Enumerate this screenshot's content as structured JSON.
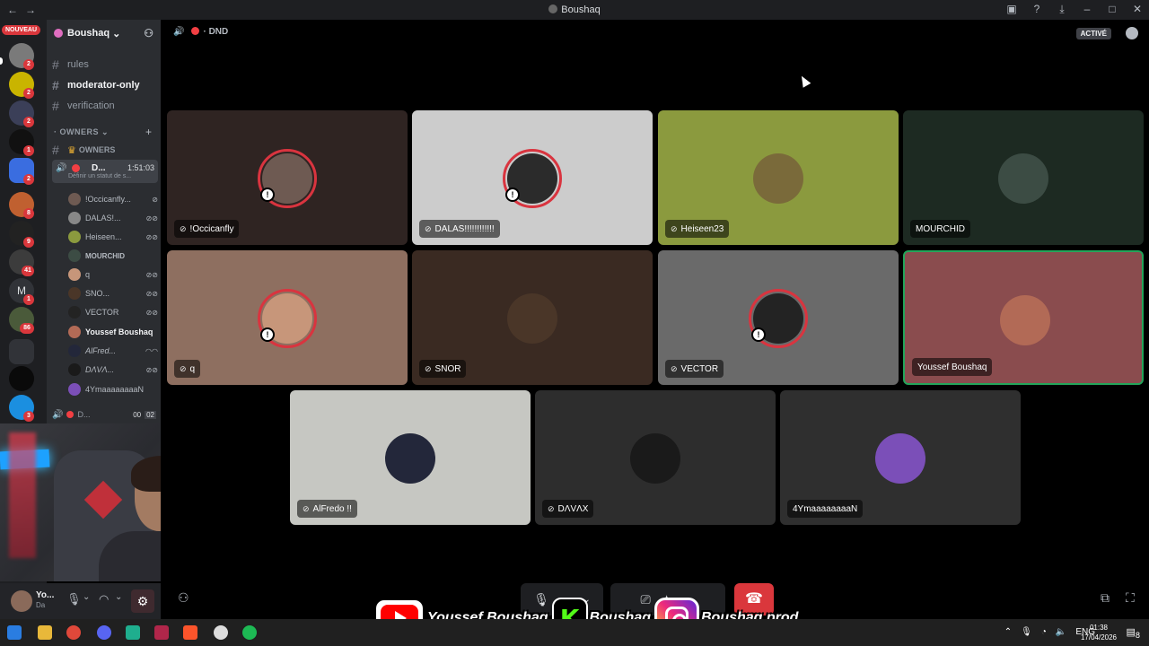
{
  "window": {
    "title": "Boushaq"
  },
  "rail": {
    "new_badge": "NOUVEAU",
    "badges": [
      "2",
      "2",
      "2",
      "1",
      "2",
      "8",
      "9",
      "41",
      "1",
      "86",
      "3"
    ],
    "letter_server": "M"
  },
  "sidebar": {
    "server_name": "Boushaq",
    "channels": [
      {
        "label": "rules"
      },
      {
        "label": "moderator-only"
      },
      {
        "label": "verification"
      }
    ],
    "category_label": "OWNERS",
    "owners_channel": "OWNERS",
    "voice": {
      "name": "D...",
      "time": "1:51:03",
      "status": "Définir un statut de s..."
    },
    "members": [
      {
        "name": "!Occicanfly..."
      },
      {
        "name": "DALAS!..."
      },
      {
        "name": "Heiseen..."
      },
      {
        "name": "MOURCHID"
      },
      {
        "name": "q"
      },
      {
        "name": "SNO..."
      },
      {
        "name": "VECTOR"
      },
      {
        "name": "Youssef Boushaq"
      },
      {
        "name": "AlFred..."
      },
      {
        "name": "DΛVΛ..."
      },
      {
        "name": "4YmaaaaaaaaN"
      }
    ],
    "voice2": {
      "name": "D...",
      "c1": "00",
      "c2": "02"
    }
  },
  "user_panel": {
    "name": "Yo...",
    "status": "Da"
  },
  "stage": {
    "header_status": "DND",
    "activity_label": "ACTIVÉ",
    "tiles": [
      {
        "name": "!Occicanfly",
        "bg": "#2f2422",
        "av": "#6e5a52"
      },
      {
        "name": "DALAS!!!!!!!!!!!!",
        "bg": "#cccccc",
        "av": "#2b2b2b"
      },
      {
        "name": "Heiseen23",
        "bg": "#8b9a3e",
        "av": "#7a6a3a"
      },
      {
        "name": "MOURCHID",
        "bg": "#1d2a22",
        "av": "#3c4c44"
      },
      {
        "name": "q",
        "bg": "#8e6f60",
        "av": "#c7967a"
      },
      {
        "name": "SNOR",
        "bg": "#3a2a22",
        "av": "#4a3628"
      },
      {
        "name": "VECTOR",
        "bg": "#6a6a6a",
        "av": "#232323"
      },
      {
        "name": "Youssef Boushaq",
        "bg": "#8a4c4e",
        "av": "#b26a56"
      },
      {
        "name": "AlFredo !!",
        "bg": "#c6c7c2",
        "av": "#23273a"
      },
      {
        "name": "DΛVΛX",
        "bg": "#2d2d2d",
        "av": "#1a1a1a"
      },
      {
        "name": "4YmaaaaaaaaN",
        "bg": "#2f2f2f",
        "av": "#7b4fb8"
      }
    ]
  },
  "overlay": {
    "youtube": "Youssef Boushaq",
    "kick": "Boushaq",
    "instagram": "Boushaq.prod"
  },
  "taskbar": {
    "lang": "ENG",
    "time": "01:38",
    "date": "17/04/2026",
    "notifications": "8"
  }
}
